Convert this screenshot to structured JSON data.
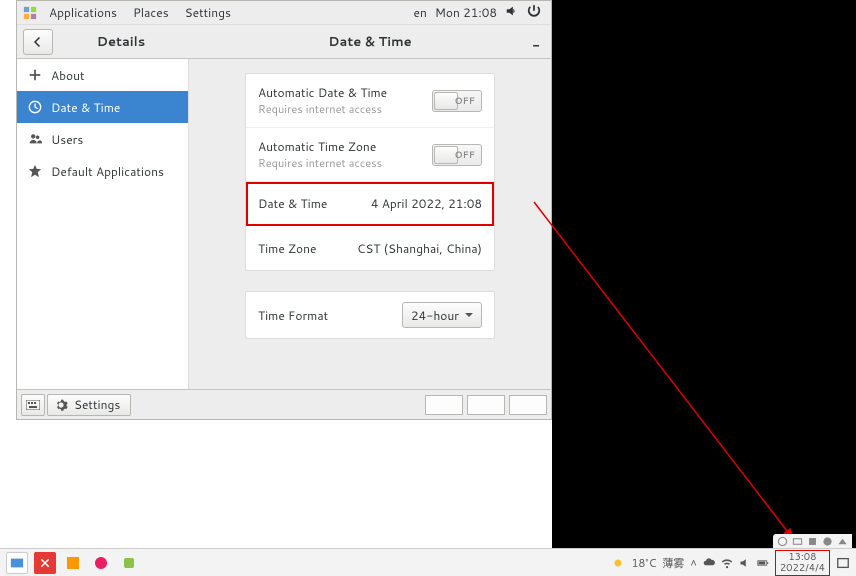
{
  "topbar": {
    "applications": "Applications",
    "places": "Places",
    "settings": "Settings",
    "lang": "en",
    "clock": "Mon 21:08"
  },
  "headerbar": {
    "left_title": "Details",
    "right_title": "Date & Time"
  },
  "sidebar": {
    "items": [
      {
        "label": "About",
        "icon": "plus"
      },
      {
        "label": "Date & Time",
        "icon": "clock"
      },
      {
        "label": "Users",
        "icon": "users"
      },
      {
        "label": "Default Applications",
        "icon": "star"
      }
    ]
  },
  "panel": {
    "group1": [
      {
        "label": "Automatic Date & Time",
        "sub": "Requires internet access",
        "switch": "OFF"
      },
      {
        "label": "Automatic Time Zone",
        "sub": "Requires internet access",
        "switch": "OFF"
      }
    ],
    "group2": [
      {
        "label": "Date & Time",
        "value": "4 April 2022, 21:08"
      },
      {
        "label": "Time Zone",
        "value": "CST (Shanghai, China)"
      }
    ],
    "group3": {
      "label": "Time Format",
      "combo": "24-hour"
    }
  },
  "bottombar": {
    "settings_label": "Settings"
  },
  "host": {
    "weather_temp": "18°C",
    "weather_desc": "薄雾",
    "clock_time": "13:08",
    "clock_date": "2022/4/4"
  }
}
